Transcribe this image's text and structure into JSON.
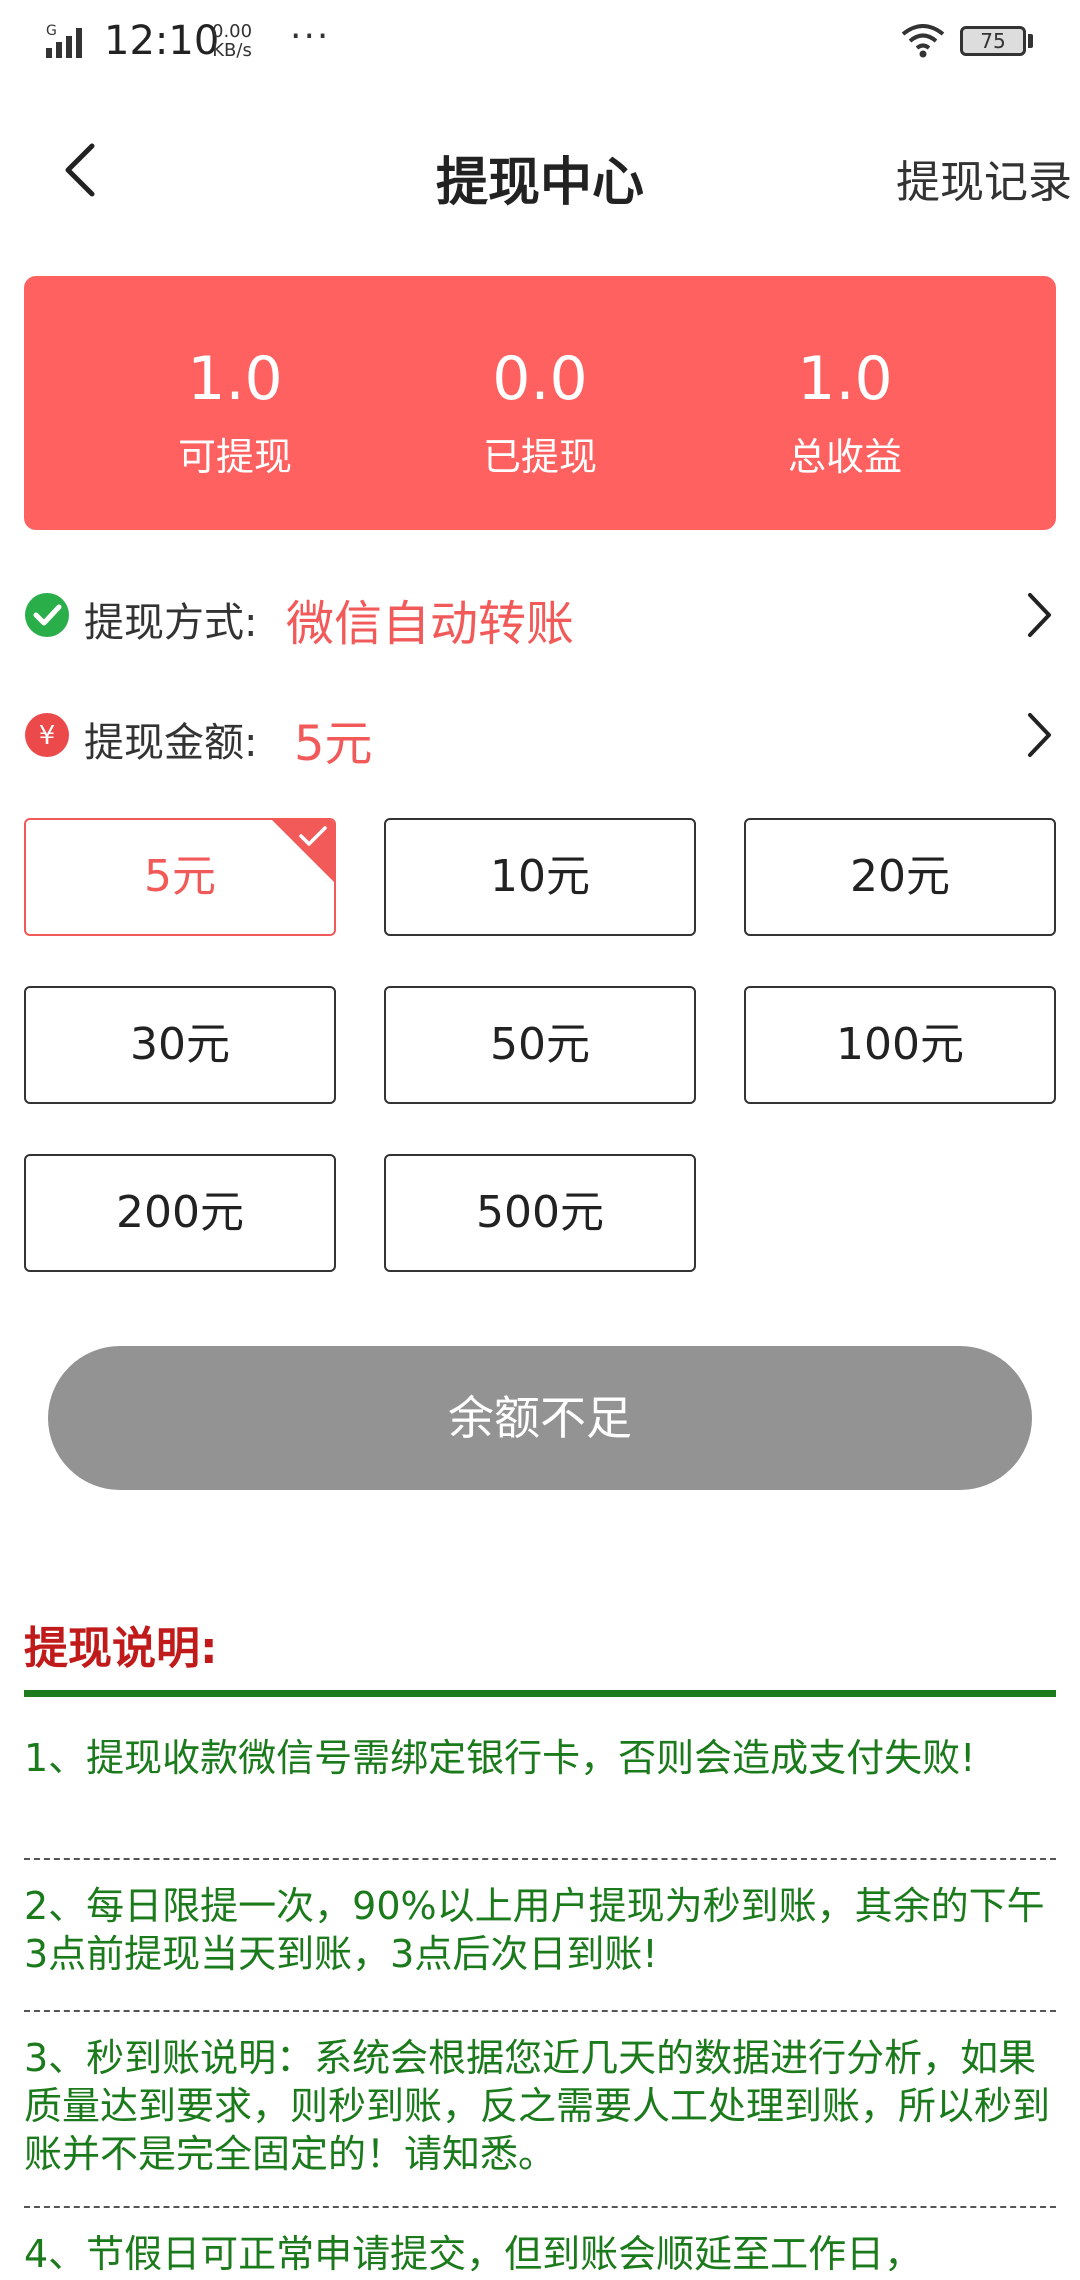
{
  "status_bar": {
    "network": "G",
    "time": "12:10",
    "speed_value": "0.00",
    "speed_unit": "KB/s",
    "more": "···",
    "battery": "75"
  },
  "header": {
    "title": "提现中心",
    "record_link": "提现记录"
  },
  "summary": {
    "color": "#fe6160",
    "stats": [
      {
        "value": "1.0",
        "label": "可提现"
      },
      {
        "value": "0.0",
        "label": "已提现"
      },
      {
        "value": "1.0",
        "label": "总收益"
      }
    ]
  },
  "method": {
    "label": "提现方式:",
    "value": "微信自动转账"
  },
  "amount": {
    "label": "提现金额:",
    "value": "5元"
  },
  "amount_options": [
    "5元",
    "10元",
    "20元",
    "30元",
    "50元",
    "100元",
    "200元",
    "500元"
  ],
  "selected_amount": "5元",
  "submit_button": "余额不足",
  "notes": {
    "title": "提现说明:",
    "items": [
      "1、提现收款微信号需绑定银行卡，否则会造成支付失败!",
      "2、每日限提一次，90%以上用户提现为秒到账，其余的下午3点前提现当天到账，3点后次日到账!",
      "3、秒到账说明：系统会根据您近几天的数据进行分析，如果质量达到要求，则秒到账，反之需要人工处理到账，所以秒到账并不是完全固定的！请知悉。",
      "4、节假日可正常申请提交，但到账会顺延至工作日，"
    ]
  },
  "colors": {
    "accent_red": "#f25a5a",
    "note_green": "#1b7a1b",
    "notes_title_red": "#c01a1a",
    "button_gray": "#939393"
  }
}
